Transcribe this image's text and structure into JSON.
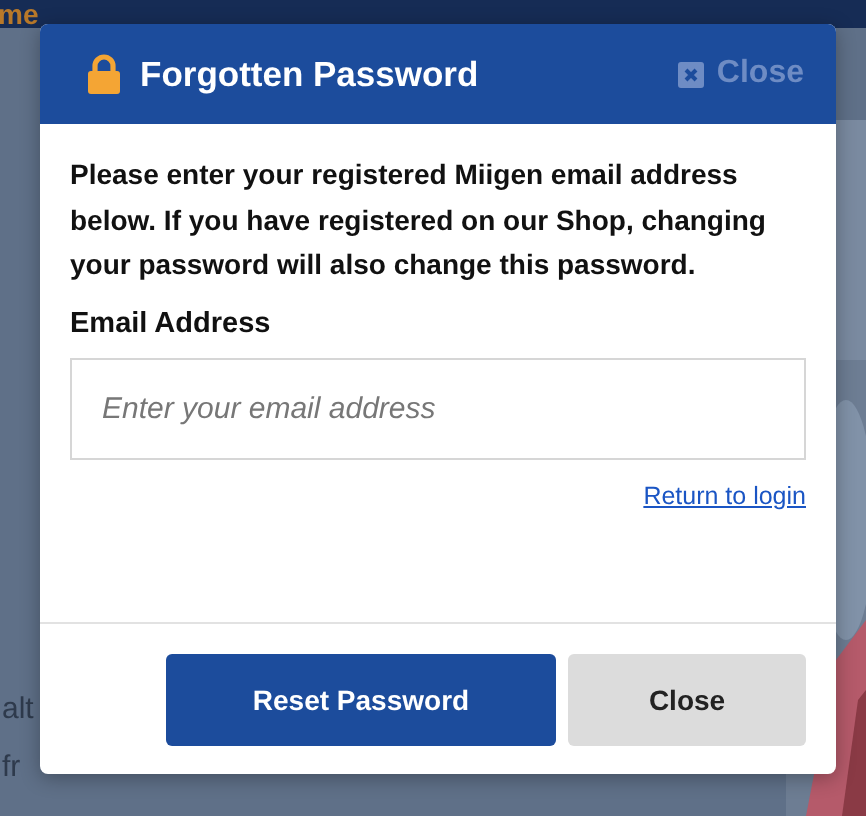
{
  "background": {
    "nav": [
      {
        "label": "me",
        "selected": true
      }
    ],
    "body_lines": [
      "alt",
      "fr"
    ]
  },
  "dialog": {
    "title": "Forgotten Password",
    "close_label": "Close",
    "message": "Please enter your registered Miigen email address below. If you have registered on our Shop, changing your password will also change this password.",
    "email": {
      "label": "Email Address",
      "placeholder": "Enter your email address"
    },
    "link": "Return to login",
    "buttons": [
      {
        "label": "Reset Password",
        "kind": "primary"
      },
      {
        "label": "Close",
        "kind": "secondary"
      }
    ]
  }
}
